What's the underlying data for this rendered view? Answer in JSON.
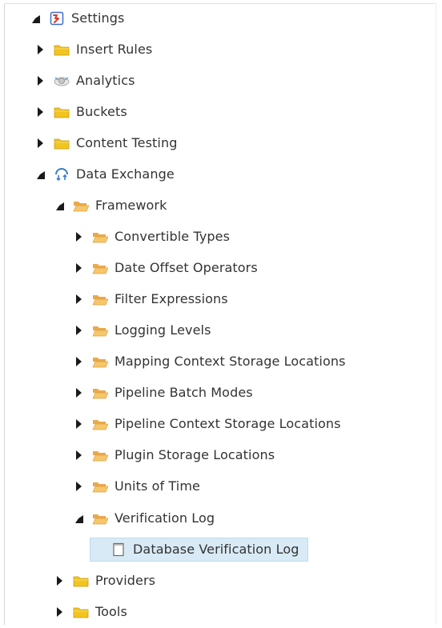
{
  "tree": {
    "root": {
      "label": "Settings",
      "icon": "settings-icon"
    },
    "insert_rules": {
      "label": "Insert Rules",
      "icon": "folder-icon"
    },
    "analytics": {
      "label": "Analytics",
      "icon": "analytics-icon"
    },
    "buckets": {
      "label": "Buckets",
      "icon": "folder-icon"
    },
    "content_testing": {
      "label": "Content Testing",
      "icon": "folder-icon"
    },
    "data_exchange": {
      "label": "Data Exchange",
      "icon": "data-exchange-icon"
    },
    "framework": {
      "label": "Framework",
      "icon": "open-folder-icon"
    },
    "convertible_types": {
      "label": "Convertible Types",
      "icon": "open-folder-icon"
    },
    "date_offset_operators": {
      "label": "Date Offset Operators",
      "icon": "open-folder-icon"
    },
    "filter_expressions": {
      "label": "Filter Expressions",
      "icon": "open-folder-icon"
    },
    "logging_levels": {
      "label": "Logging Levels",
      "icon": "open-folder-icon"
    },
    "mapping_context_storage_locations": {
      "label": "Mapping Context Storage Locations",
      "icon": "open-folder-icon"
    },
    "pipeline_batch_modes": {
      "label": "Pipeline Batch Modes",
      "icon": "open-folder-icon"
    },
    "pipeline_context_storage_locations": {
      "label": "Pipeline Context Storage Locations",
      "icon": "open-folder-icon"
    },
    "plugin_storage_locations": {
      "label": "Plugin Storage Locations",
      "icon": "open-folder-icon"
    },
    "units_of_time": {
      "label": "Units of Time",
      "icon": "open-folder-icon"
    },
    "verification_log": {
      "label": "Verification Log",
      "icon": "open-folder-icon"
    },
    "database_verification_log": {
      "label": "Database Verification Log",
      "icon": "document-icon",
      "selected": true
    },
    "providers": {
      "label": "Providers",
      "icon": "folder-icon"
    },
    "tools": {
      "label": "Tools",
      "icon": "folder-icon"
    }
  },
  "colors": {
    "selection_bg": "#d8eaf5",
    "folder_yellow": "#f2c420",
    "folder_open": "#f6c66a",
    "text": "#333333"
  }
}
